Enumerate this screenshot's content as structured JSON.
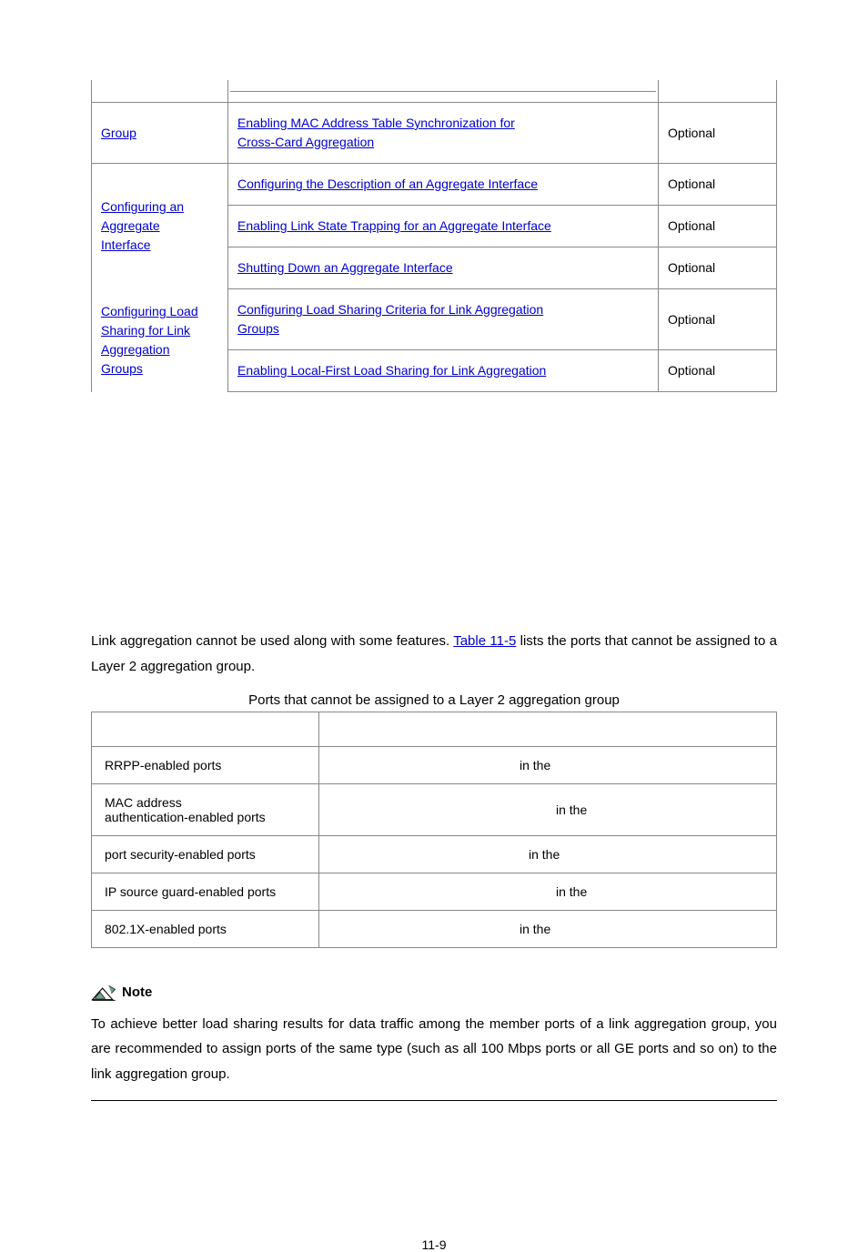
{
  "table1": {
    "r1_c1": "Group",
    "r1_c2a": "Enabling MAC Address Table Synchronization for ",
    "r1_c2b": "Cross-Card Aggregation",
    "r1_c3": "Optional",
    "r2_c1a": "Configuring an ",
    "r2_c1b": "Aggregate ",
    "r2_c1c": "Interface",
    "r2a_c2": "Configuring the Description of an Aggregate Interface",
    "r2a_c3": "Optional",
    "r2b_c2": "Enabling Link State Trapping for an Aggregate Interface",
    "r2b_c3": "Optional",
    "r2c_c2": "Shutting Down an Aggregate Interface",
    "r2c_c3": "Optional",
    "r3_c1a": "Configuring Load ",
    "r3_c1b": "Sharing for Link ",
    "r3_c1c": "Aggregation ",
    "r3_c1d": "Groups",
    "r3a_c2a": "Configuring Load Sharing Criteria for Link Aggregation ",
    "r3a_c2b": "Groups",
    "r3a_c3": "Optional",
    "r3b_c2": "Enabling Local-First Load Sharing for Link Aggregation",
    "r3b_c3": "Optional"
  },
  "para1_a": "Link aggregation cannot be used along with some features. ",
  "para1_link": "Table 11-5",
  "para1_b": " lists the ports that cannot be assigned to a Layer 2 aggregation group.",
  "caption": "Ports that cannot be assigned to a Layer 2 aggregation group",
  "table2": {
    "r1_c1": "RRPP-enabled ports",
    "r1_c2": " in the ",
    "r2_c1a": "MAC address",
    "r2_c1b": "authentication-enabled ports",
    "r2_c2": " in the ",
    "r3_c1": "port security-enabled ports",
    "r3_c2": " in the ",
    "r4_c1": "IP source guard-enabled ports",
    "r4_c2": " in the ",
    "r5_c1": "802.1X-enabled ports",
    "r5_c2": " in the "
  },
  "note_label": "Note",
  "note_text": "To achieve better load sharing results for data traffic among the member ports of a link aggregation group, you are recommended to assign ports of the same type (such as all 100 Mbps ports or all GE ports and so on) to the link aggregation group.",
  "page_number": "11-9"
}
